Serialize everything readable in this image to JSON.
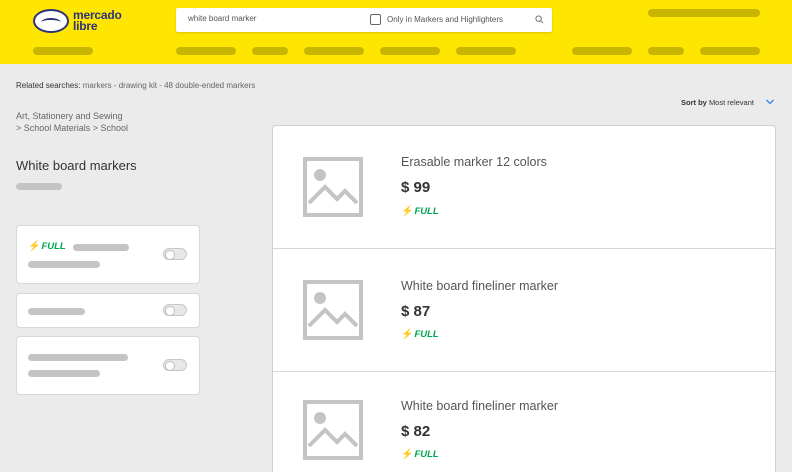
{
  "header": {
    "logo": {
      "line1": "mercado",
      "line2": "libre"
    },
    "search": {
      "value": "white board marker",
      "checkbox_label": "Only in Markers and Highlighters"
    }
  },
  "related": {
    "label": "Related searches:",
    "items": "markers - drawing kit - 48 double-ended markers"
  },
  "breadcrumb": {
    "line1": "Art, Stationery and Sewing",
    "line2": "> School Materials > School"
  },
  "sort": {
    "label": "Sort by",
    "value": "Most relevant"
  },
  "category_title": "White board markers",
  "filters": {
    "full_label": "FULL"
  },
  "products": [
    {
      "title": "Erasable marker 12 colors",
      "price": "$ 99",
      "shipping": "FULL"
    },
    {
      "title": "White board fineliner marker",
      "price": "$ 87",
      "shipping": "FULL"
    },
    {
      "title": "White board fineliner marker",
      "price": "$ 82",
      "shipping": "FULL"
    }
  ],
  "colors": {
    "header_bg": "#ffe600",
    "full_green": "#00a650",
    "brand_blue": "#2d3277"
  },
  "icons": {
    "search": "search-icon",
    "sort": "chevron-down-icon",
    "thumb": "image-placeholder-icon",
    "full": "lightning-bolt-icon"
  }
}
